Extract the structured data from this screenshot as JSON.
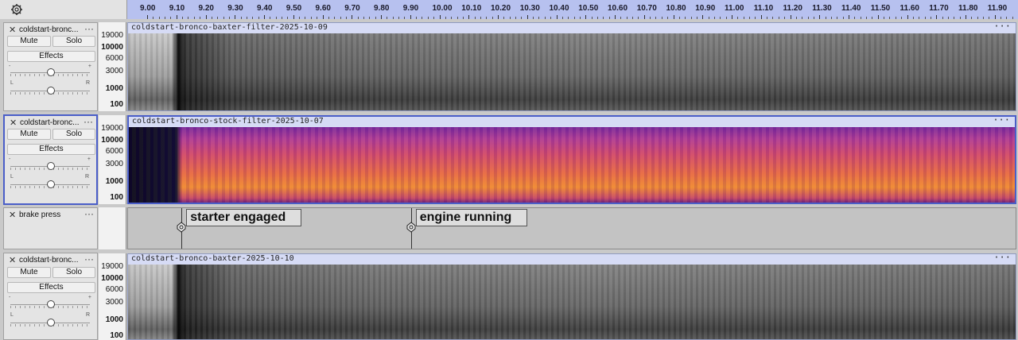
{
  "ruler": {
    "ticks": [
      "9.00",
      "9.10",
      "9.20",
      "9.30",
      "9.40",
      "9.50",
      "9.60",
      "9.70",
      "9.80",
      "9.90",
      "10.00",
      "10.10",
      "10.20",
      "10.30",
      "10.40",
      "10.50",
      "10.60",
      "10.70",
      "10.80",
      "10.90",
      "11.00",
      "11.10",
      "11.20",
      "11.30",
      "11.40",
      "11.50",
      "11.60",
      "11.70",
      "11.80",
      "11.90"
    ]
  },
  "common": {
    "mute_label": "Mute",
    "solo_label": "Solo",
    "effects_label": "Effects",
    "close_glyph": "✕",
    "menu_glyph": "···",
    "gain_minus": "-",
    "gain_plus": "+",
    "pan_left": "L",
    "pan_right": "R",
    "clip_menu_glyph": "···"
  },
  "scale_labels": [
    "19000",
    "10000",
    "6000",
    "3000",
    "1000",
    "100"
  ],
  "tracks": [
    {
      "name": "coldstart-bronc...",
      "clip_title": "coldstart-bronco-baxter-filter-2025-10-09",
      "view": "grayscale",
      "selected": false
    },
    {
      "name": "coldstart-bronc...",
      "clip_title": "coldstart-bronco-stock-filter-2025-10-07",
      "view": "color",
      "selected": true
    },
    {
      "name": "coldstart-bronc...",
      "clip_title": "coldstart-bronco-baxter-2025-10-10",
      "view": "grayscale",
      "selected": false
    }
  ],
  "label_track": {
    "name": "brake press",
    "labels": [
      {
        "text": "starter engaged",
        "time": 9.115
      },
      {
        "text": "engine running",
        "time": 9.9
      }
    ]
  },
  "colors": {
    "ruler_scale": "#b7c1ef",
    "selection_border": "#4a5ec8",
    "clip_title_bg": "#d6dbf5"
  }
}
